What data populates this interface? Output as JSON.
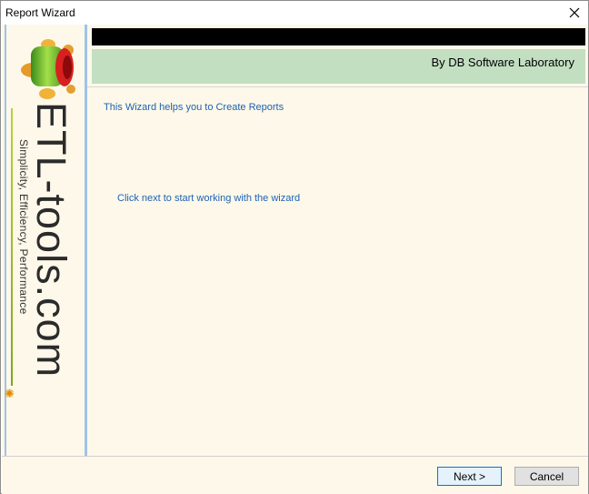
{
  "window": {
    "title": "Report Wizard"
  },
  "sidebar": {
    "brand": "ETL-tools.com",
    "tagline": "Simplicity, Efficiency, Performance"
  },
  "header": {
    "banner_text": "By DB Software Laboratory"
  },
  "content": {
    "intro": "This Wizard helps you to Create Reports",
    "hint": "Click next to start working with the wizard"
  },
  "footer": {
    "next_label": "Next >",
    "cancel_label": "Cancel"
  },
  "colors": {
    "banner": "#c3dfc2",
    "background": "#fdf8e9",
    "link_text": "#1d62b3",
    "sidebar_border": "#9fc3e8"
  }
}
